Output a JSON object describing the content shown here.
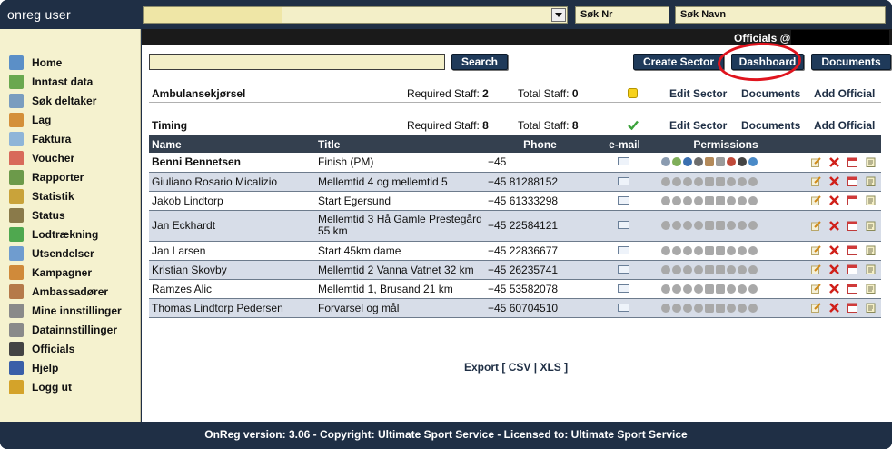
{
  "app": {
    "title": "onreg user"
  },
  "topbar": {
    "search_nr": "Søk Nr",
    "search_navn": "Søk Navn"
  },
  "header": {
    "officials_label": "Officials @"
  },
  "toolbar": {
    "search_label": "Search",
    "create_sector_label": "Create Sector",
    "dashboard_label": "Dashboard",
    "documents_label": "Documents"
  },
  "sidebar": {
    "items": [
      {
        "label": "Home",
        "icon": "home-icon",
        "color": "#5b8fc7"
      },
      {
        "label": "Inntast data",
        "icon": "user-add-icon",
        "color": "#6aa84f"
      },
      {
        "label": "Søk deltaker",
        "icon": "search-user-icon",
        "color": "#7a9dbf"
      },
      {
        "label": "Lag",
        "icon": "team-icon",
        "color": "#d4903a"
      },
      {
        "label": "Faktura",
        "icon": "invoice-icon",
        "color": "#8fb5d8"
      },
      {
        "label": "Voucher",
        "icon": "gift-icon",
        "color": "#d86a5a"
      },
      {
        "label": "Rapporter",
        "icon": "report-icon",
        "color": "#6c9a4a"
      },
      {
        "label": "Statistik",
        "icon": "bar-chart-icon",
        "color": "#c9a33a"
      },
      {
        "label": "Status",
        "icon": "status-icon",
        "color": "#8a7a4a"
      },
      {
        "label": "Lodtrækning",
        "icon": "lottery-icon",
        "color": "#4fa84f"
      },
      {
        "label": "Utsendelser",
        "icon": "mail-send-icon",
        "color": "#6f9ccf"
      },
      {
        "label": "Kampagner",
        "icon": "campaign-icon",
        "color": "#d08a3a"
      },
      {
        "label": "Ambassadører",
        "icon": "ambassador-icon",
        "color": "#b57a4a"
      },
      {
        "label": "Mine innstillinger",
        "icon": "gear-icon",
        "color": "#8a8a8a"
      },
      {
        "label": "Datainnstillinger",
        "icon": "tools-icon",
        "color": "#8a8a8a"
      },
      {
        "label": "Officials",
        "icon": "officials-icon",
        "color": "#444444"
      },
      {
        "label": "Hjelp",
        "icon": "help-icon",
        "color": "#3a5fa8"
      },
      {
        "label": "Logg ut",
        "icon": "lock-icon",
        "color": "#d4a32a"
      }
    ]
  },
  "sectors": [
    {
      "name": "Ambulansekjørsel",
      "required_label": "Required Staff:",
      "required": "2",
      "total_label": "Total Staff:",
      "total": "0",
      "status_icon": "yellow-status-icon",
      "edit": "Edit Sector",
      "documents": "Documents",
      "add": "Add Official"
    },
    {
      "name": "Timing",
      "required_label": "Required Staff:",
      "required": "8",
      "total_label": "Total Staff:",
      "total": "8",
      "status_icon": "green-check-icon",
      "edit": "Edit Sector",
      "documents": "Documents",
      "add": "Add Official"
    }
  ],
  "table": {
    "headers": {
      "name": "Name",
      "title": "Title",
      "phone": "Phone",
      "email": "e-mail",
      "permissions": "Permissions"
    },
    "rows": [
      {
        "name": "Benni Bennetsen",
        "title": "Finish (PM)",
        "phone": "+45"
      },
      {
        "name": "Giuliano Rosario Micalizio",
        "title": "Mellemtid 4 og mellemtid 5",
        "phone": "+45 81288152"
      },
      {
        "name": "Jakob Lindtorp",
        "title": "Start Egersund",
        "phone": "+45 61333298"
      },
      {
        "name": "Jan Eckhardt",
        "title": "Mellemtid 3 Hå Gamle Prestegård 55 km",
        "phone": "+45 22584121"
      },
      {
        "name": "Jan Larsen",
        "title": "Start 45km dame",
        "phone": "+45 22836677"
      },
      {
        "name": "Kristian Skovby",
        "title": "Mellemtid 2 Vanna Vatnet 32 km",
        "phone": "+45 26235741"
      },
      {
        "name": "Ramzes Alic",
        "title": "Mellemtid 1, Brusand 21 km",
        "phone": "+45 53582078"
      },
      {
        "name": "Thomas Lindtorp Pedersen",
        "title": "Forvarsel og mål",
        "phone": "+45 60704510"
      }
    ]
  },
  "export": {
    "label": "Export",
    "open": "[",
    "csv": "CSV",
    "sep": "|",
    "xls": "XLS",
    "close": "]"
  },
  "footer": {
    "text": "OnReg version: 3.06 - Copyright: Ultimate Sport Service - Licensed to: Ultimate Sport Service"
  }
}
